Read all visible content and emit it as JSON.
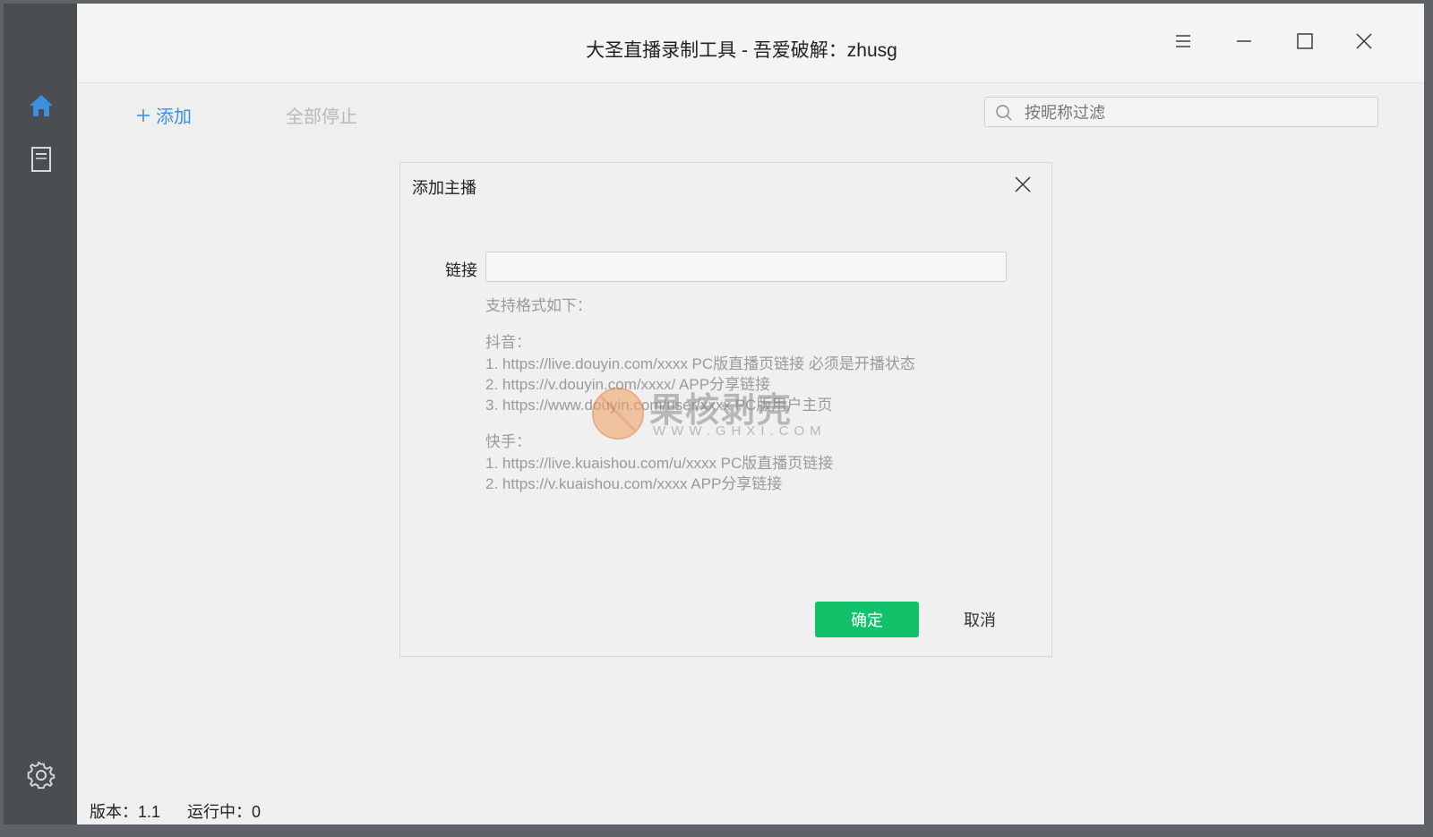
{
  "window": {
    "title": "大圣直播录制工具 - 吾爱破解：zhusg"
  },
  "sidebar": {
    "items": [
      {
        "icon": "home-icon",
        "color": "#3d8fe0"
      },
      {
        "icon": "document-icon"
      }
    ],
    "settings_icon": "gear-icon"
  },
  "toolbar": {
    "add_label": "添加",
    "stop_all_label": "全部停止",
    "search": {
      "placeholder": "按昵称过滤",
      "value": ""
    }
  },
  "dialog": {
    "title": "添加主播",
    "link_label": "链接",
    "link_value": "",
    "hint_title": "支持格式如下：",
    "groups": [
      {
        "name": "抖音：",
        "lines": [
          "1. https://live.douyin.com/xxxx PC版直播页链接 必须是开播状态",
          "2. https://v.douyin.com/xxxx/ APP分享链接",
          "3. https://www.douyin.com/user/xxxx PC版用户主页"
        ]
      },
      {
        "name": "快手：",
        "lines": [
          "1. https://live.kuaishou.com/u/xxxx PC版直播页链接",
          "2. https://v.kuaishou.com/xxxx APP分享链接"
        ]
      }
    ],
    "confirm_label": "确定",
    "cancel_label": "取消",
    "confirm_color": "#12c26b"
  },
  "watermark": {
    "text": "果核剥壳",
    "sub": "WWW.GHXI.COM"
  },
  "status": {
    "version": "版本：1.1",
    "running": "运行中：0"
  }
}
